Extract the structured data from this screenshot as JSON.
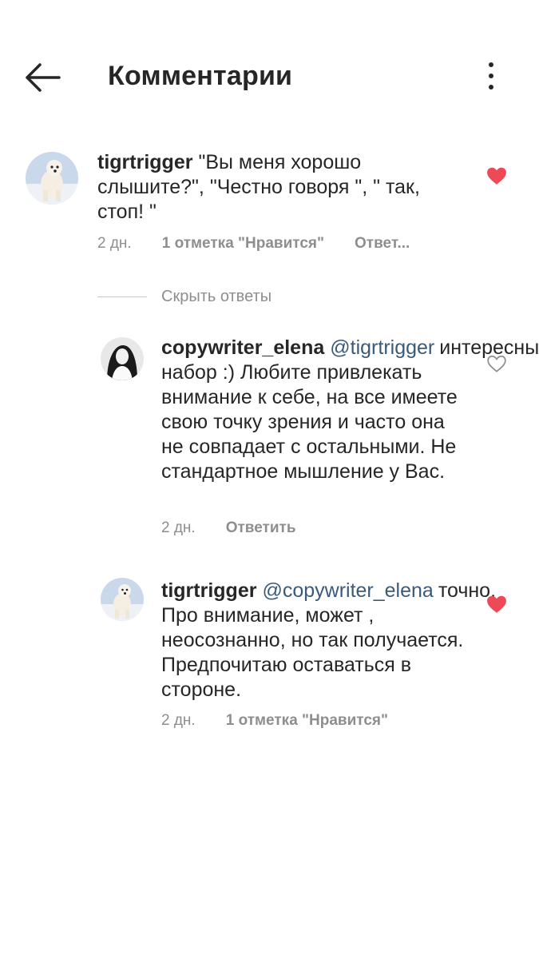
{
  "header": {
    "title": "Комментарии"
  },
  "hide_replies_label": "Скрыть ответы",
  "comments": [
    {
      "username": "tigrtrigger",
      "mention": "",
      "text": "\"Вы меня хорошо слышите?\", \"Честно говоря \", \" так, стоп! \"",
      "time": "2 дн.",
      "likes": "1 отметка \"Нравится\"",
      "reply": "Ответ...",
      "liked": true
    },
    {
      "username": "copywriter_elena",
      "mention": "@tigrtrigger",
      "text": "интересный набор :) Любите привлекать внимание к себе, на все имеете свою точку зрения и часто она не совпадает с остальными. Не стандартное мышление у Вас.",
      "time": "2 дн.",
      "likes": "",
      "reply": "Ответить",
      "liked": false
    },
    {
      "username": "tigrtrigger",
      "mention": "@copywriter_elena",
      "text": "точно. Про внимание, может , неосознанно, но так получается. Предпочитаю оставаться в стороне.",
      "time": "2 дн.",
      "likes": "1 отметка \"Нравится\"",
      "reply": "",
      "liked": true
    }
  ],
  "colors": {
    "heart_liked": "#ed4956",
    "heart_outline": "#8e8e8e",
    "mention": "#3a5a7a",
    "meta": "#8e8e8e"
  },
  "icons": [
    "back-arrow-icon",
    "more-vertical-icon",
    "heart-filled-icon",
    "heart-outline-icon"
  ]
}
